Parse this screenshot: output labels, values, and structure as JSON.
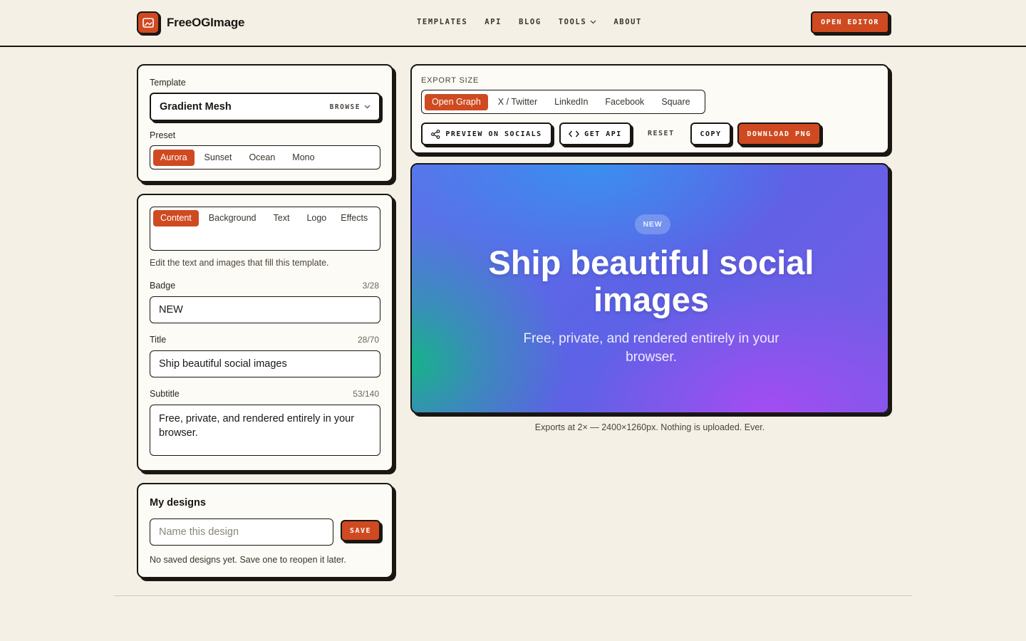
{
  "brand": {
    "name": "FreeOGImage"
  },
  "nav": {
    "templates": "TEMPLATES",
    "api": "API",
    "blog": "BLOG",
    "tools": "TOOLS",
    "about": "ABOUT"
  },
  "header": {
    "open_editor": "OPEN EDITOR"
  },
  "template_panel": {
    "template_label": "Template",
    "template_value": "Gradient Mesh",
    "browse": "BROWSE",
    "preset_label": "Preset",
    "presets": [
      "Aurora",
      "Sunset",
      "Ocean",
      "Mono"
    ],
    "active_preset": "Aurora"
  },
  "content_panel": {
    "tabs": [
      "Content",
      "Background",
      "Text",
      "Logo",
      "Effects"
    ],
    "active_tab": "Content",
    "description": "Edit the text and images that fill this template.",
    "badge_label": "Badge",
    "badge_counter": "3/28",
    "badge_value": "NEW",
    "title_label": "Title",
    "title_counter": "28/70",
    "title_value": "Ship beautiful social images",
    "subtitle_label": "Subtitle",
    "subtitle_counter": "53/140",
    "subtitle_value": "Free, private, and rendered entirely in your browser."
  },
  "designs_panel": {
    "heading": "My designs",
    "name_placeholder": "Name this design",
    "save": "SAVE",
    "empty": "No saved designs yet. Save one to reopen it later."
  },
  "export": {
    "label": "EXPORT SIZE",
    "sizes": [
      "Open Graph",
      "X / Twitter",
      "LinkedIn",
      "Facebook",
      "Square"
    ],
    "active_size": "Open Graph",
    "preview_socials": "PREVIEW ON SOCIALS",
    "get_api": "GET API",
    "reset": "RESET",
    "copy": "COPY",
    "download": "DOWNLOAD PNG"
  },
  "preview": {
    "badge": "NEW",
    "title": "Ship beautiful social images",
    "subtitle": "Free, private, and rendered entirely in your browser."
  },
  "export_note": "Exports at 2× — 2400×1260px. Nothing is uploaded. Ever.",
  "colors": {
    "accent": "#cf4a20",
    "ink": "#1a1612",
    "background": "#f4f0e6",
    "card": "#fdfbf5"
  }
}
